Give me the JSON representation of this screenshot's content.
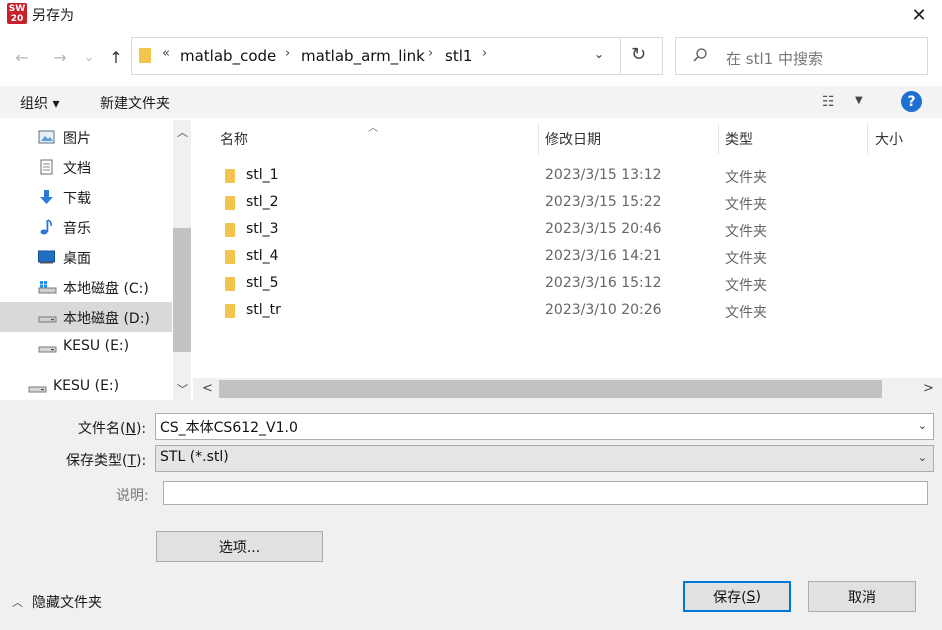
{
  "window": {
    "title": "另存为",
    "app_icon_text": "SW",
    "close_glyph": "✕"
  },
  "nav": {
    "back_glyph": "←",
    "forward_glyph": "→",
    "recent_glyph": "⌄",
    "up_glyph": "↑",
    "path_prefix": "«",
    "breadcrumb": [
      "matlab_code",
      "matlab_arm_link",
      "stl1"
    ],
    "separator": "›",
    "dropdown_glyph": "⌄",
    "refresh_glyph": "↻"
  },
  "search": {
    "placeholder": "在 stl1 中搜索"
  },
  "toolbar": {
    "organize_label": "组织 ▾",
    "new_folder_label": "新建文件夹",
    "view_glyph": "☷",
    "view_caret": "▼",
    "help_glyph": "?"
  },
  "sidebar": {
    "items": [
      {
        "label": "图片",
        "icon": "pictures-icon",
        "selected": false
      },
      {
        "label": "文档",
        "icon": "documents-icon",
        "selected": false
      },
      {
        "label": "下载",
        "icon": "downloads-icon",
        "selected": false
      },
      {
        "label": "音乐",
        "icon": "music-icon",
        "selected": false
      },
      {
        "label": "桌面",
        "icon": "desktop-icon",
        "selected": false
      },
      {
        "label": "本地磁盘 (C:)",
        "icon": "system-drive-icon",
        "selected": false
      },
      {
        "label": "本地磁盘 (D:)",
        "icon": "drive-icon",
        "selected": true
      },
      {
        "label": "KESU (E:)",
        "icon": "usb-drive-icon",
        "selected": false
      },
      {
        "label": "KESU (E:)",
        "icon": "usb-drive-icon",
        "selected": false
      }
    ],
    "scroll_up_glyph": "︿",
    "scroll_down_glyph": "﹀"
  },
  "file_list": {
    "columns": [
      "名称",
      "修改日期",
      "类型",
      "大小"
    ],
    "sort_caret": "︿",
    "rows": [
      {
        "name": "stl_1",
        "date": "2023/3/15 13:12",
        "type": "文件夹"
      },
      {
        "name": "stl_2",
        "date": "2023/3/15 15:22",
        "type": "文件夹"
      },
      {
        "name": "stl_3",
        "date": "2023/3/15 20:46",
        "type": "文件夹"
      },
      {
        "name": "stl_4",
        "date": "2023/3/16 14:21",
        "type": "文件夹"
      },
      {
        "name": "stl_5",
        "date": "2023/3/16 15:12",
        "type": "文件夹"
      },
      {
        "name": "stl_tr",
        "date": "2023/3/10 20:26",
        "type": "文件夹"
      }
    ],
    "hscroll_left_glyph": "<",
    "hscroll_right_glyph": ">"
  },
  "form": {
    "filename_label_pre": "文件名(",
    "filename_label_key": "N",
    "filename_label_post": "):",
    "filename_value": "CS_本体CS612_V1.0",
    "filetype_label_pre": "保存类型(",
    "filetype_label_key": "T",
    "filetype_label_post": "):",
    "filetype_value": "STL (*.stl)",
    "description_label": "说明:",
    "description_value": "",
    "options_label": "选项...",
    "dd_caret": "⌄"
  },
  "footer": {
    "hide_folders_caret": "︿",
    "hide_folders_label": "隐藏文件夹",
    "save_label_pre": "保存(",
    "save_label_key": "S",
    "save_label_post": ")",
    "cancel_label": "取消"
  }
}
